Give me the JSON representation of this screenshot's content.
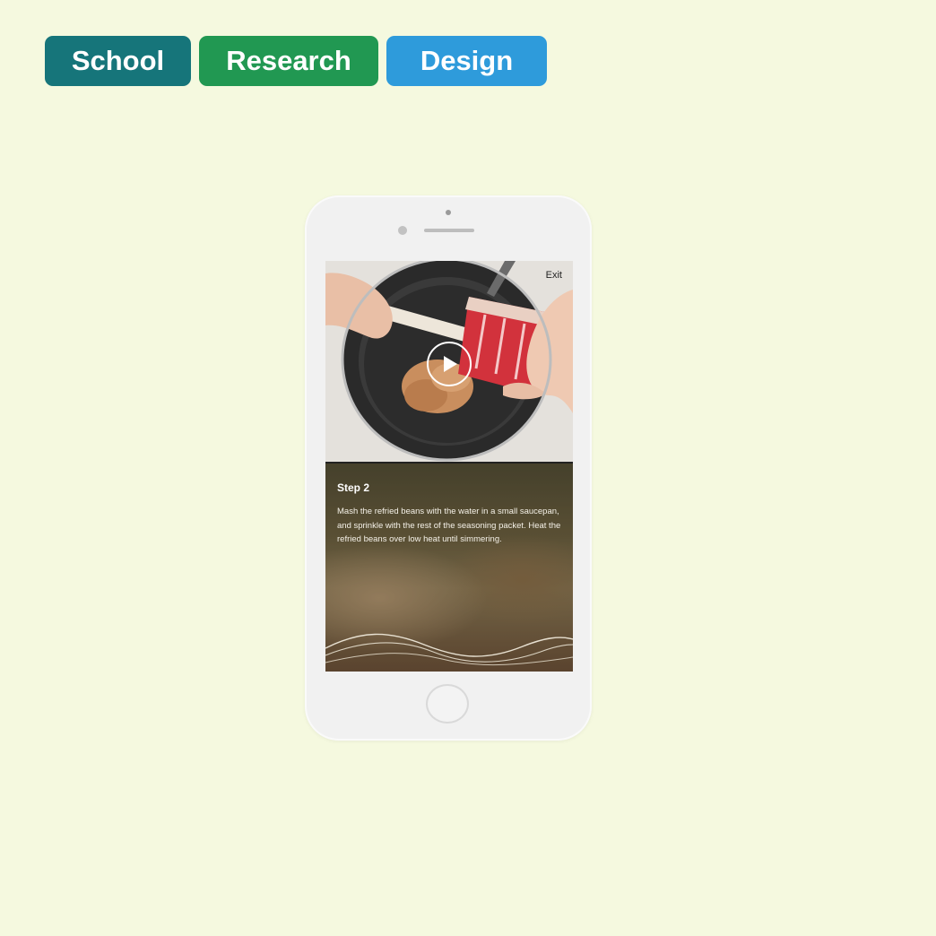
{
  "tags": [
    {
      "label": "School",
      "color": "#16757A"
    },
    {
      "label": "Research",
      "color": "#219852"
    },
    {
      "label": "Design",
      "color": "#2E9BDB"
    }
  ],
  "video": {
    "exit_label": "Exit",
    "play_icon": "play-icon"
  },
  "step": {
    "title": "Step 2",
    "text": "Mash the refried beans with the water in a small saucepan, and sprinkle with the rest of the seasoning packet. Heat the refried beans over low heat until simmering."
  },
  "colors": {
    "background": "#F5F9DF",
    "phone": "#F1F1F1"
  }
}
